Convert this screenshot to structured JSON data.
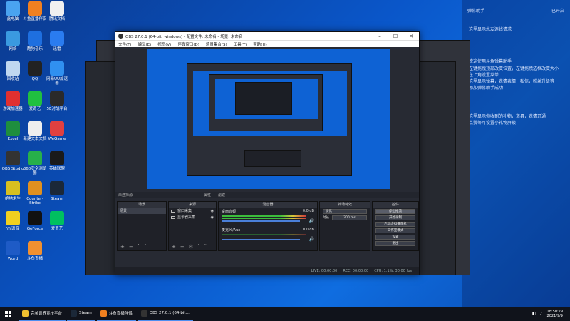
{
  "desktop_icons": [
    {
      "label": "此电脑",
      "color": "#4aa3f0"
    },
    {
      "label": "斗鱼直播伴侣",
      "color": "#f08020"
    },
    {
      "label": "腾讯文档",
      "color": "#f0f0f0"
    },
    {
      "label": "网络",
      "color": "#3a9ae0"
    },
    {
      "label": "酷狗音乐",
      "color": "#1e6fe0"
    },
    {
      "label": "迅雷",
      "color": "#2a7cf0"
    },
    {
      "label": "回收站",
      "color": "#c0d8f0"
    },
    {
      "label": "QQ",
      "color": "#222"
    },
    {
      "label": "网易UU加速器",
      "color": "#3090f0"
    },
    {
      "label": "游戏加速器",
      "color": "#e03030"
    },
    {
      "label": "爱奇艺",
      "color": "#20c040"
    },
    {
      "label": "5E对战平台",
      "color": "#2a2a2a"
    },
    {
      "label": "Excel",
      "color": "#1e8e3e"
    },
    {
      "label": "新建文本文档",
      "color": "#eeeeee"
    },
    {
      "label": "WeGame",
      "color": "#e04040"
    },
    {
      "label": "OBS Studio",
      "color": "#333"
    },
    {
      "label": "360安全浏览器",
      "color": "#27b04a"
    },
    {
      "label": "英雄联盟",
      "color": "#1a1a1a"
    },
    {
      "label": "绝地求生",
      "color": "#d8c020"
    },
    {
      "label": "Counter-Strike",
      "color": "#e09020"
    },
    {
      "label": "Steam",
      "color": "#1b2838"
    },
    {
      "label": "YY语音",
      "color": "#f0d020"
    },
    {
      "label": "GeForce",
      "color": "#111"
    },
    {
      "label": "爱奇艺",
      "color": "#00c060"
    },
    {
      "label": "Word",
      "color": "#1e5bc6"
    },
    {
      "label": "斗鱼直播",
      "color": "#f09030"
    }
  ],
  "assistant": {
    "title": "弹幕助手",
    "status": "已开启",
    "sub_left": "",
    "sub_right": "",
    "messages": [
      "这里显示水友连线请求",
      "欢迎使用斗鱼弹幕助手",
      "左键拖拽顶部改变位置，左键拖拽边框改变大小",
      "在上角设置菜单",
      "这里显示弹幕，表情表情，私信，粉丝升级等",
      "添加弹幕助手成功",
      "这里显示你收到的礼物，道具，表情开通",
      "点赞等可设置小礼物屏蔽"
    ]
  },
  "obs": {
    "title": "OBS 27.0.1 (64-bit, windows) - 配置文件: 未命名 - 场景: 未命名",
    "menu": [
      "文件(F)",
      "编辑(E)",
      "视图(V)",
      "停靠窗口(D)",
      "场景集合(S)",
      "工具(T)",
      "帮助(H)"
    ],
    "no_source": "未选择源",
    "properties": "属性",
    "filters": "滤镜",
    "docks": {
      "scenes": "场景",
      "sources": "来源",
      "mixer": "混音器",
      "transitions": "转场特效",
      "controls": "控件"
    },
    "scene_items": [
      "场景"
    ],
    "source_items": [
      "窗口采集",
      "显示器采集"
    ],
    "mixer_tracks": [
      {
        "name": "桌面音频",
        "db": "0.0 dB"
      },
      {
        "name": "麦克风/Aux",
        "db": "0.0 dB"
      }
    ],
    "transition": "淡化",
    "duration_label": "时长",
    "duration": "300 ms",
    "control_buttons": [
      "停止推流",
      "开始录制",
      "启动虚拟摄像机",
      "工作室模式",
      "设置",
      "退出"
    ],
    "status": {
      "live": "LIVE: 00:00:00",
      "rec": "REC: 00:00:00",
      "cpu": "CPU: 1.1%, 30.00 fps"
    }
  },
  "taskbar": {
    "apps": [
      {
        "label": "完美世界竞技平台",
        "color": "#f0c030"
      },
      {
        "label": "Steam",
        "color": "#1b2838"
      },
      {
        "label": "斗鱼直播伴侣",
        "color": "#f08020"
      },
      {
        "label": "OBS 27.0.1 (64-bit...",
        "color": "#333"
      }
    ],
    "time": "18:50:29",
    "date": "2021/9/9"
  }
}
